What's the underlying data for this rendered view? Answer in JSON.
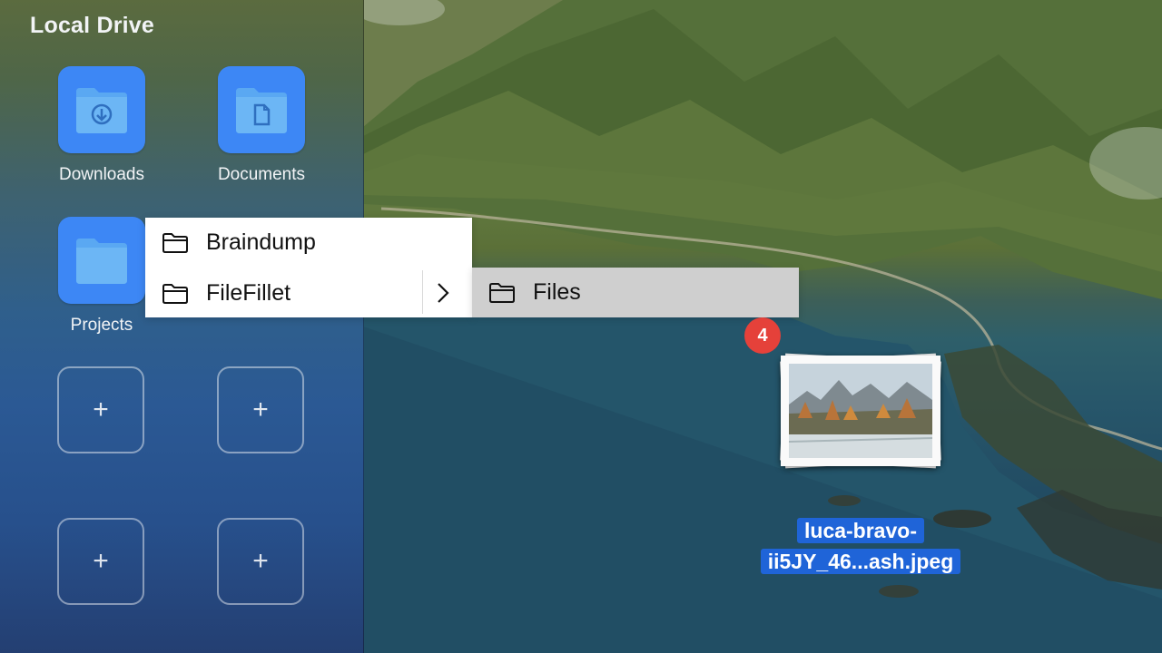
{
  "sidebar": {
    "title": "Local Drive",
    "folders": [
      {
        "label": "Downloads",
        "icon": "download-folder-icon"
      },
      {
        "label": "Documents",
        "icon": "document-folder-icon"
      },
      {
        "label": "Projects",
        "icon": "folder-icon"
      }
    ],
    "empty_slots": [
      "+",
      "+",
      "+",
      "+"
    ]
  },
  "menu": {
    "items": [
      {
        "label": "Braindump",
        "icon": "folder-outline-icon"
      },
      {
        "label": "FileFillet",
        "icon": "folder-outline-icon",
        "has_submenu": true
      }
    ],
    "chevron": ">"
  },
  "submenu": {
    "items": [
      {
        "label": "Files",
        "icon": "folder-outline-icon",
        "highlighted": true
      }
    ]
  },
  "drag": {
    "badge_count": "4",
    "file_name_line1": "luca-bravo-",
    "file_name_line2": "ii5JY_46...ash.jpeg"
  },
  "colors": {
    "folder_blue": "#3d87f5",
    "badge_red": "#e5413a",
    "selection_blue": "#1f64d8",
    "submenu_highlight": "#cfcfcf"
  }
}
